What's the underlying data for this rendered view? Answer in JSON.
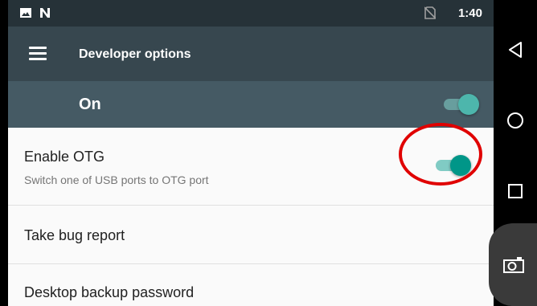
{
  "status_bar": {
    "time": "1:40",
    "icons": [
      "image-icon",
      "n-notification-icon",
      "no-sim-icon"
    ]
  },
  "toolbar": {
    "title": "Developer options",
    "menu_icon": "hamburger-menu-icon"
  },
  "master_switch": {
    "label": "On",
    "state": "on"
  },
  "settings": [
    {
      "title": "Enable OTG",
      "subtitle": "Switch one of USB ports to OTG port",
      "toggle": "on"
    },
    {
      "title": "Take bug report"
    },
    {
      "title": "Desktop backup password"
    }
  ],
  "nav_bar": {
    "buttons": [
      "back-icon",
      "home-icon",
      "recents-icon",
      "camera-icon"
    ]
  },
  "colors": {
    "status_bar": "#263238",
    "toolbar": "#37474f",
    "master_bar": "#455a64",
    "accent": "#009688",
    "accent_track": "#80cbc4",
    "highlight_ring": "#e00000"
  }
}
